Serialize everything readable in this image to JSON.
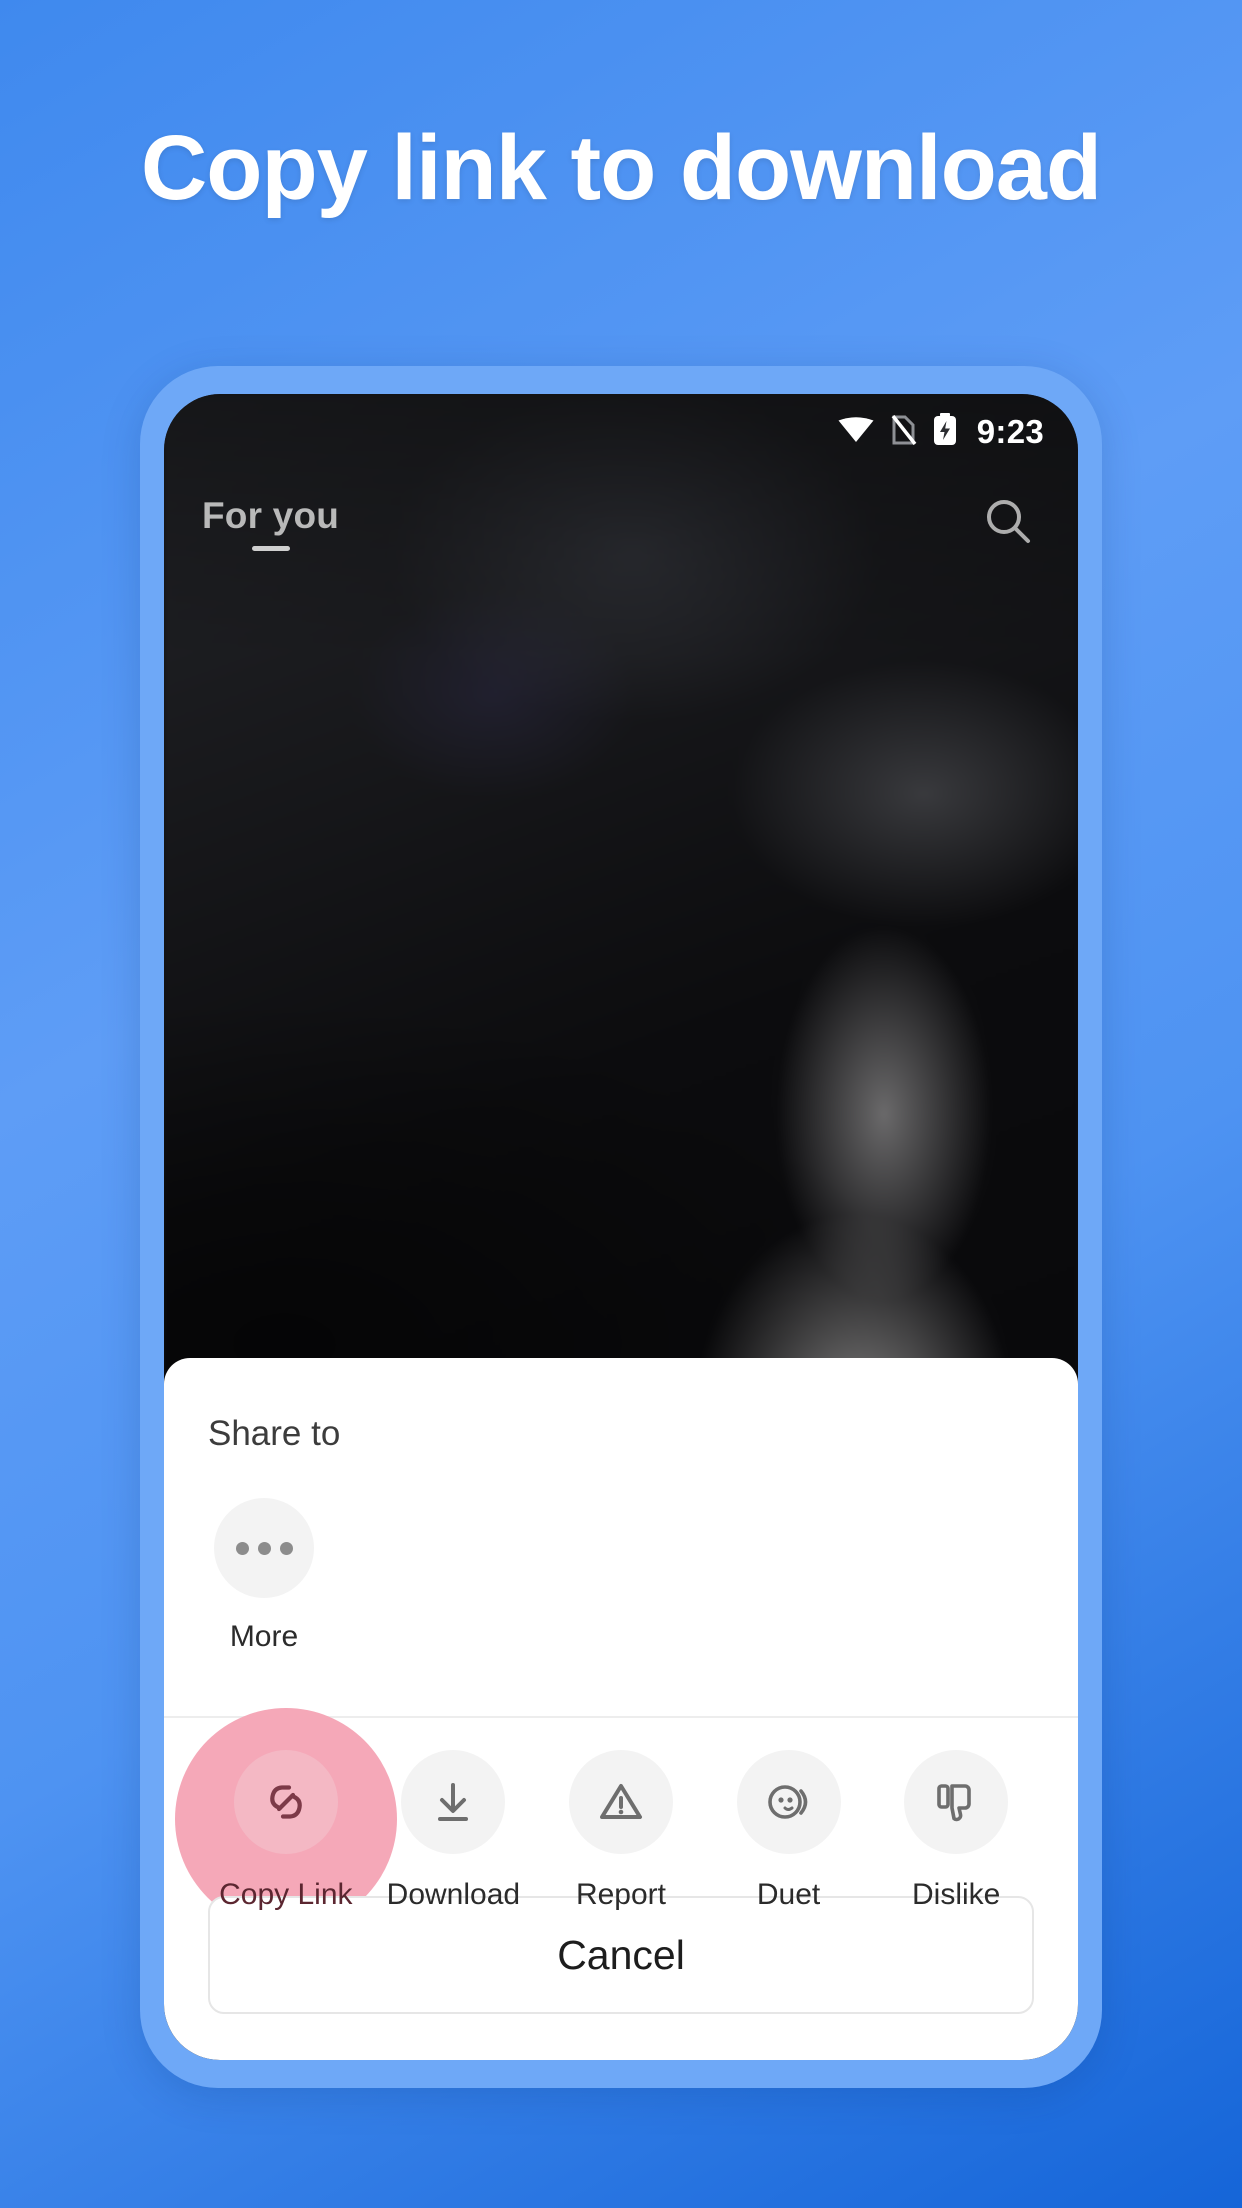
{
  "headline": "Copy link to download",
  "theme": {
    "bg_gradient_from": "#3f89ee",
    "bg_gradient_to": "#1565d8",
    "phone_bezel": "#6ea8f7",
    "highlight_pink": "#f5a8b8",
    "sheet_bg": "#ffffff",
    "icon_circle_bg": "#f3f3f3"
  },
  "phone": {
    "status_bar": {
      "time": "9:23",
      "icons": [
        "wifi-icon",
        "no-sim-icon",
        "battery-charging-icon"
      ]
    },
    "top_nav": {
      "feed_tab_label": "For you",
      "search_icon": "search-icon"
    },
    "share_sheet": {
      "title": "Share to",
      "share_targets": [
        {
          "label": "More",
          "icon": "more-dots-icon"
        }
      ],
      "actions": [
        {
          "label": "Copy Link",
          "icon": "link-icon",
          "highlighted": true
        },
        {
          "label": "Download",
          "icon": "download-icon",
          "highlighted": false
        },
        {
          "label": "Report",
          "icon": "warning-triangle-icon",
          "highlighted": false
        },
        {
          "label": "Duet",
          "icon": "duet-face-icon",
          "highlighted": false
        },
        {
          "label": "Dislike",
          "icon": "thumbs-down-icon",
          "highlighted": false
        }
      ],
      "cancel_label": "Cancel"
    }
  }
}
